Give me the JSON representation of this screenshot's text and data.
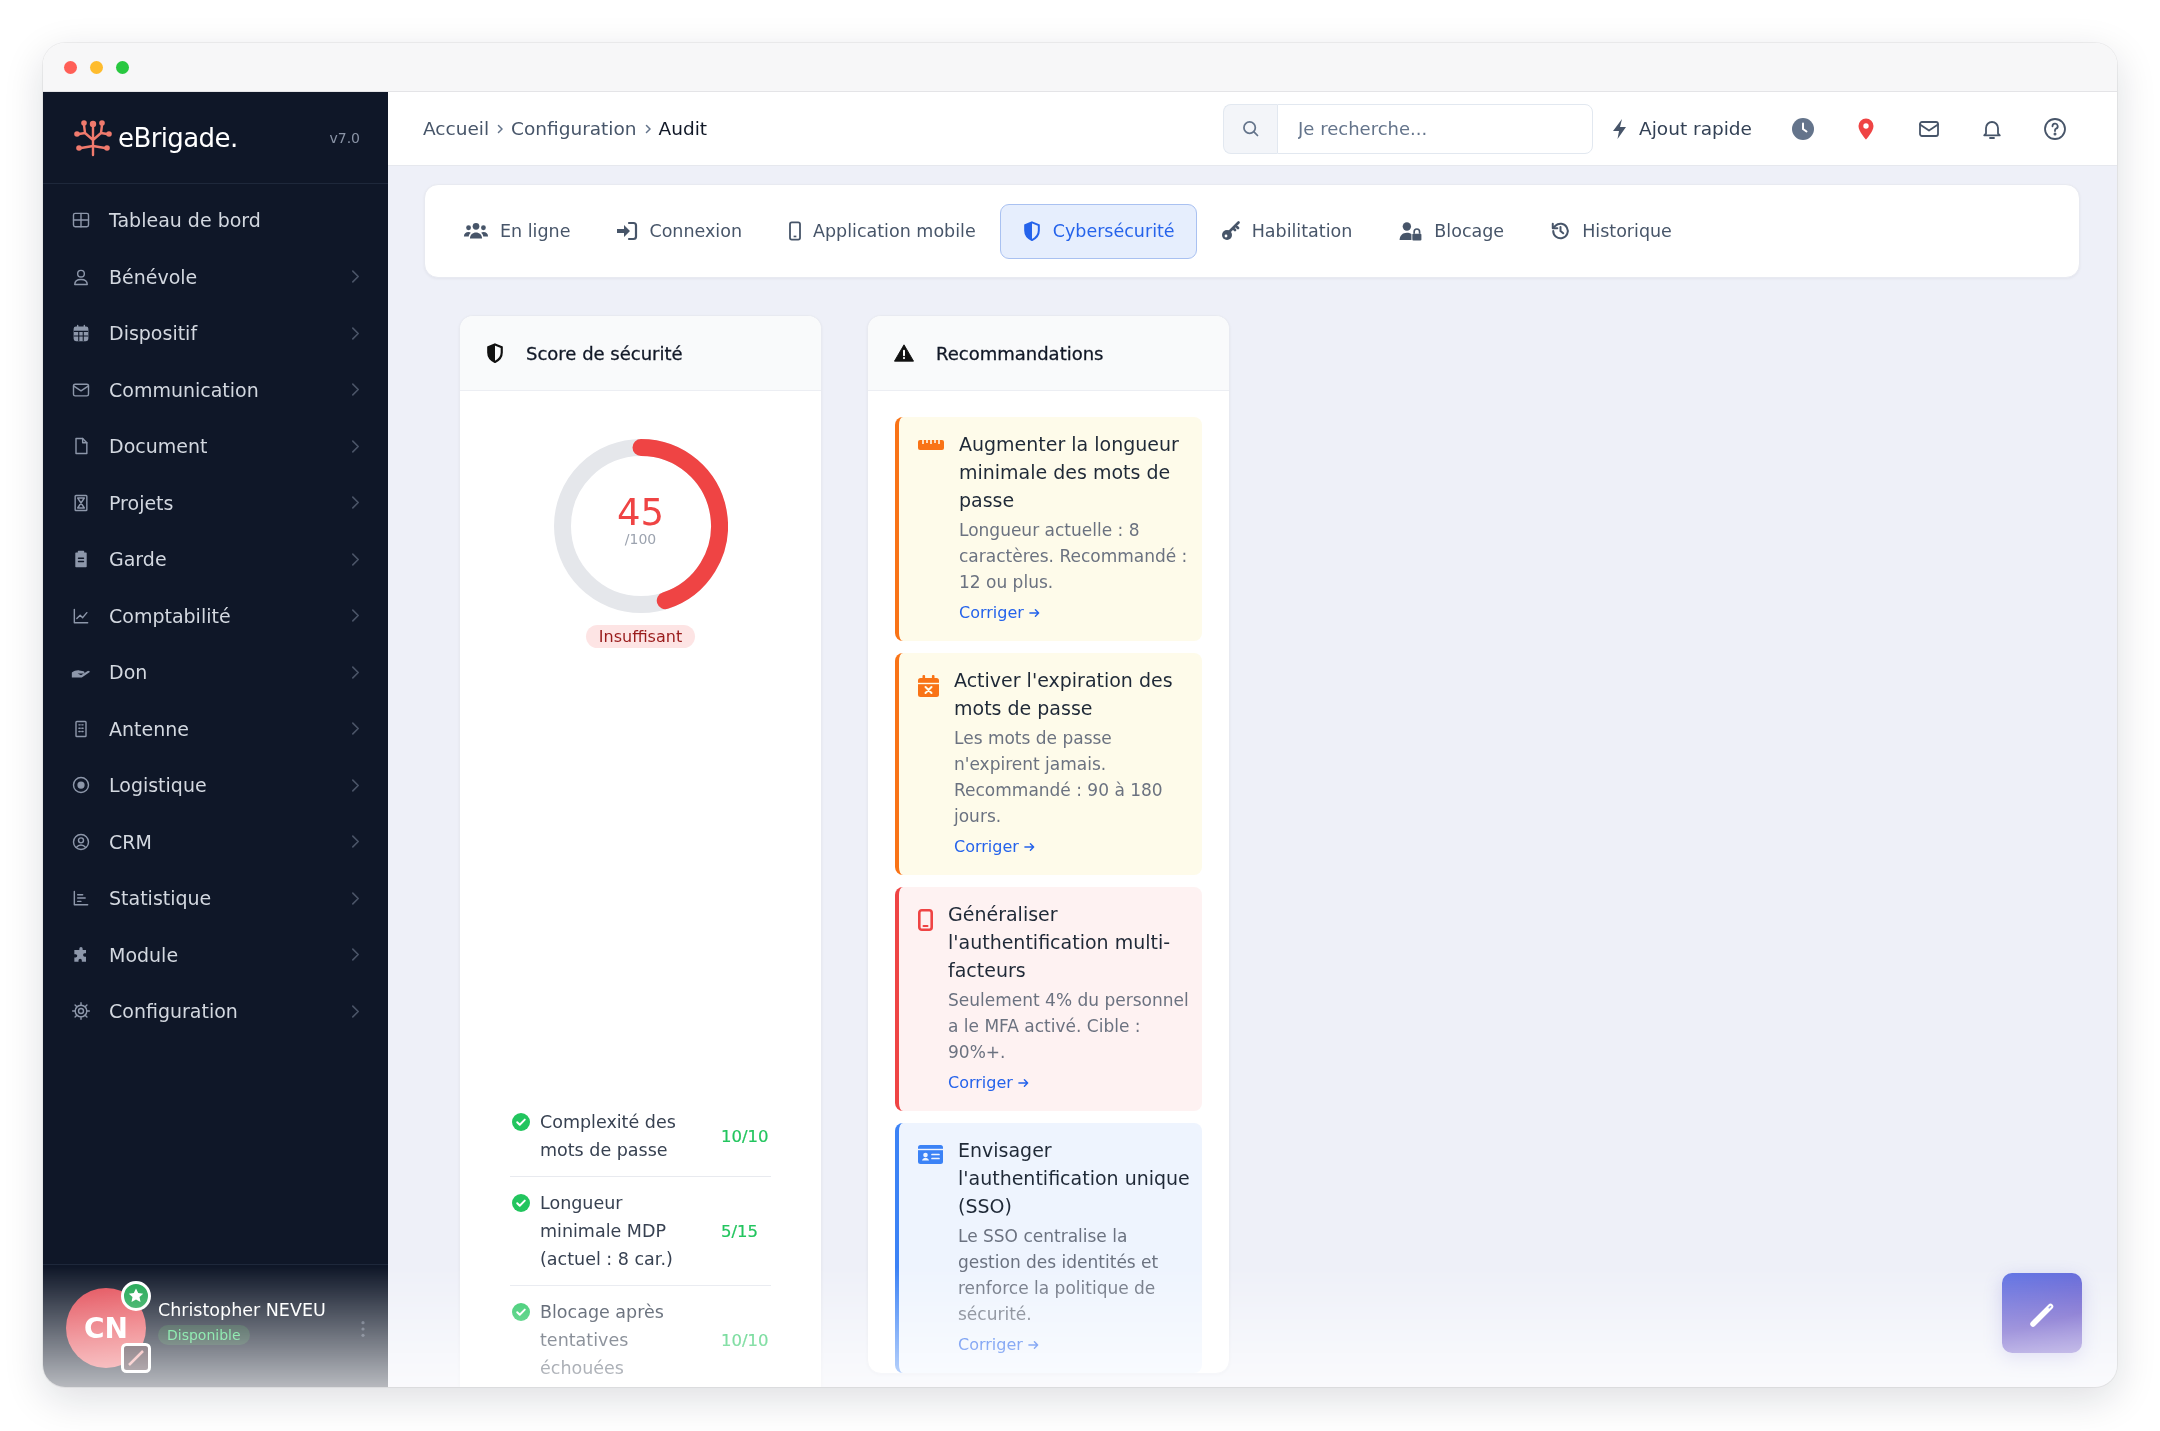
{
  "sidebar": {
    "logo": "eBrigade.",
    "version": "v7.0",
    "items": [
      {
        "label": "Tableau de bord",
        "has_submenu": false
      },
      {
        "label": "Bénévole",
        "has_submenu": true
      },
      {
        "label": "Dispositif",
        "has_submenu": true
      },
      {
        "label": "Communication",
        "has_submenu": true
      },
      {
        "label": "Document",
        "has_submenu": true
      },
      {
        "label": "Projets",
        "has_submenu": true
      },
      {
        "label": "Garde",
        "has_submenu": true
      },
      {
        "label": "Comptabilité",
        "has_submenu": true
      },
      {
        "label": "Don",
        "has_submenu": true
      },
      {
        "label": "Antenne",
        "has_submenu": true
      },
      {
        "label": "Logistique",
        "has_submenu": true
      },
      {
        "label": "CRM",
        "has_submenu": true
      },
      {
        "label": "Statistique",
        "has_submenu": true
      },
      {
        "label": "Module",
        "has_submenu": true
      },
      {
        "label": "Configuration",
        "has_submenu": true
      }
    ],
    "user": {
      "initials": "CN",
      "name": "Christopher NEVEU",
      "status": "Disponible"
    }
  },
  "topbar": {
    "breadcrumb": [
      {
        "label": "Accueil",
        "current": false
      },
      {
        "label": "Configuration",
        "current": false
      },
      {
        "label": "Audit",
        "current": true
      }
    ],
    "search": {
      "placeholder": "Je recherche..."
    },
    "quick_add": "Ajout rapide"
  },
  "tabs": [
    {
      "label": "En ligne",
      "selected": false
    },
    {
      "label": "Connexion",
      "selected": false
    },
    {
      "label": "Application mobile",
      "selected": false
    },
    {
      "label": "Cybersécurité",
      "selected": true
    },
    {
      "label": "Habilitation",
      "selected": false
    },
    {
      "label": "Blocage",
      "selected": false
    },
    {
      "label": "Historique",
      "selected": false
    }
  ],
  "score_card": {
    "title": "Score de sécurité",
    "score": "45",
    "max": "/100",
    "level": 0.45,
    "rating": "Insuffisant",
    "criteria": [
      {
        "label": "Complexité des mots de passe",
        "points": "10/10"
      },
      {
        "label": "Longueur minimale MDP (actuel : 8 car.)",
        "points": "5/15"
      },
      {
        "label": "Blocage après tentatives échouées",
        "points": "10/10"
      }
    ]
  },
  "recommendations": {
    "title": "Recommandations",
    "items": [
      {
        "kind": "warning",
        "title": "Augmenter la longueur minimale des mots de passe",
        "text": "Longueur actuelle : 8 caractères. Recommandé : 12 ou plus.",
        "link": "Corriger"
      },
      {
        "kind": "warning",
        "title": "Activer l'expiration des mots de passe",
        "text": "Les mots de passe n'expirent jamais. Recommandé : 90 à 180 jours.",
        "link": "Corriger"
      },
      {
        "kind": "danger",
        "title": "Généraliser l'authentification multi-facteurs",
        "text": "Seulement 4% du personnel a le MFA activé. Cible : 90%+.",
        "link": "Corriger"
      },
      {
        "kind": "info",
        "title": "Envisager l'authentification unique (SSO)",
        "text": "Le SSO centralise la gestion des identités et renforce la politique de sécurité.",
        "link": "Corriger"
      }
    ]
  }
}
